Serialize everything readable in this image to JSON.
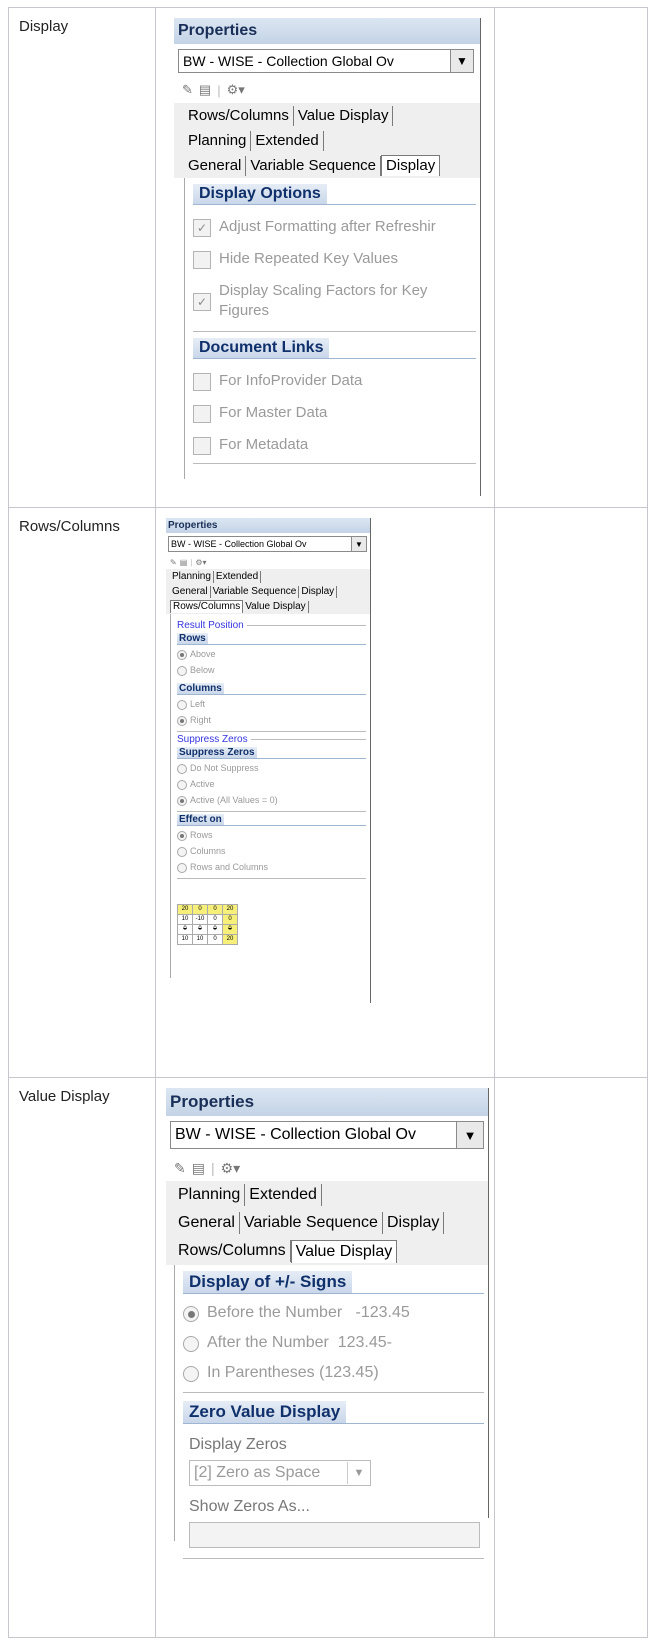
{
  "rows": [
    {
      "label": "Display",
      "panel": {
        "title": "Properties",
        "selector": "BW - WISE - Collection Global Ov",
        "tabs_row1": [
          "Rows/Columns",
          "Value Display"
        ],
        "tabs_row2": [
          "Planning",
          "Extended"
        ],
        "tabs_row3": [
          "General",
          "Variable Sequence",
          "Display"
        ],
        "active_tab": "Display",
        "section1": {
          "title": "Display Options",
          "options": [
            {
              "label": "Adjust Formatting after Refreshir",
              "checked": true
            },
            {
              "label": "Hide Repeated Key Values",
              "checked": false
            },
            {
              "label": "Display Scaling Factors for Key Figures",
              "checked": true
            }
          ]
        },
        "section2": {
          "title": "Document Links",
          "options": [
            {
              "label": "For InfoProvider Data",
              "checked": false
            },
            {
              "label": "For Master Data",
              "checked": false
            },
            {
              "label": "For Metadata",
              "checked": false
            }
          ]
        }
      }
    },
    {
      "label": "Rows/Columns",
      "panel": {
        "title": "Properties",
        "selector": "BW - WISE - Collection Global Ov",
        "tabs_row1": [
          "Planning",
          "Extended"
        ],
        "tabs_row2": [
          "General",
          "Variable Sequence",
          "Display"
        ],
        "tabs_row3": [
          "Rows/Columns",
          "Value Display"
        ],
        "active_tab": "Rows/Columns",
        "group1": {
          "title": "Result Position",
          "rows": {
            "title": "Rows",
            "options": [
              "Above",
              "Below"
            ],
            "selected": 0
          },
          "columns": {
            "title": "Columns",
            "options": [
              "Left",
              "Right"
            ],
            "selected": 1
          }
        },
        "group2": {
          "title": "Suppress Zeros",
          "suppress": {
            "title": "Suppress Zeros",
            "options": [
              "Do Not Suppress",
              "Active",
              "Active (All Values = 0)"
            ],
            "selected": 2
          },
          "effect": {
            "title": "Effect on",
            "options": [
              "Rows",
              "Columns",
              "Rows and Columns"
            ],
            "selected": 0
          }
        },
        "mini_table": [
          [
            "20",
            "0",
            "0",
            "20"
          ],
          [
            "10",
            "-10",
            "0",
            "0"
          ],
          [
            "0",
            "0",
            "0",
            "0"
          ],
          [
            "10",
            "10",
            "0",
            "20"
          ]
        ]
      }
    },
    {
      "label": "Value Display",
      "panel": {
        "title": "Properties",
        "selector": "BW - WISE - Collection Global Ov",
        "tabs_row1": [
          "Planning",
          "Extended"
        ],
        "tabs_row2": [
          "General",
          "Variable Sequence",
          "Display"
        ],
        "tabs_row3": [
          "Rows/Columns",
          "Value Display"
        ],
        "active_tab": "Value Display",
        "section1": {
          "title": "Display of +/- Signs",
          "options": [
            "Before the Number   -123.45",
            "After the Number  123.45-",
            "In Parentheses (123.45)"
          ],
          "selected": 0
        },
        "section2": {
          "title": "Zero Value Display",
          "display_zeros_label": "Display Zeros",
          "display_zeros_value": "[2] Zero as Space",
          "show_zeros_label": "Show Zeros As...",
          "show_zeros_value": ""
        }
      }
    }
  ]
}
